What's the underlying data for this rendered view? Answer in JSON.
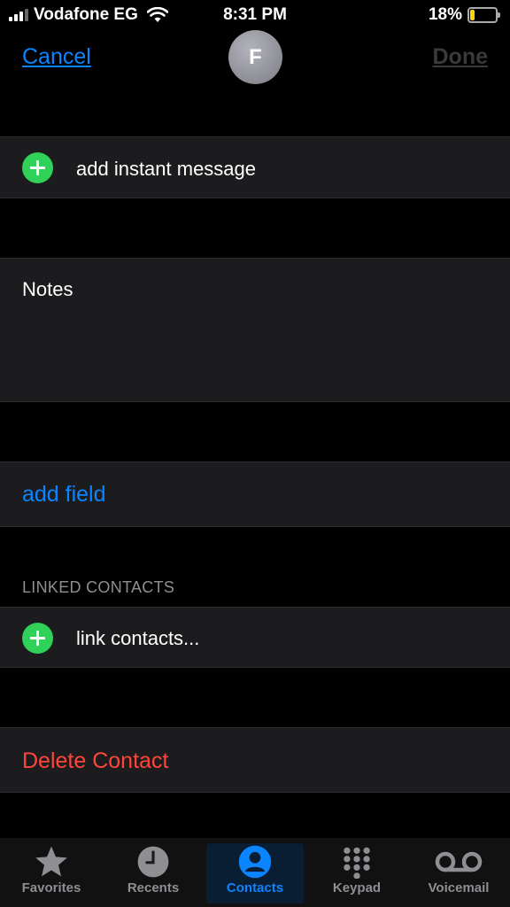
{
  "status": {
    "carrier": "Vodafone EG",
    "time": "8:31 PM",
    "battery": "18%",
    "battery_level": 0.18
  },
  "nav": {
    "cancel": "Cancel",
    "done": "Done",
    "avatar_initial": "F"
  },
  "rows": {
    "instant_message": "add instant message",
    "notes": "Notes",
    "add_field": "add field",
    "linked_header": "LINKED CONTACTS",
    "link_contacts": "link contacts...",
    "delete": "Delete Contact"
  },
  "tabs": [
    {
      "label": "Favorites",
      "icon": "star-icon"
    },
    {
      "label": "Recents",
      "icon": "clock-icon"
    },
    {
      "label": "Contacts",
      "icon": "person-icon",
      "active": true
    },
    {
      "label": "Keypad",
      "icon": "keypad-icon"
    },
    {
      "label": "Voicemail",
      "icon": "voicemail-icon"
    }
  ],
  "colors": {
    "accent": "#0a84ff",
    "destructive": "#ff453a",
    "add": "#30d158",
    "battery": "#ffd60a"
  }
}
